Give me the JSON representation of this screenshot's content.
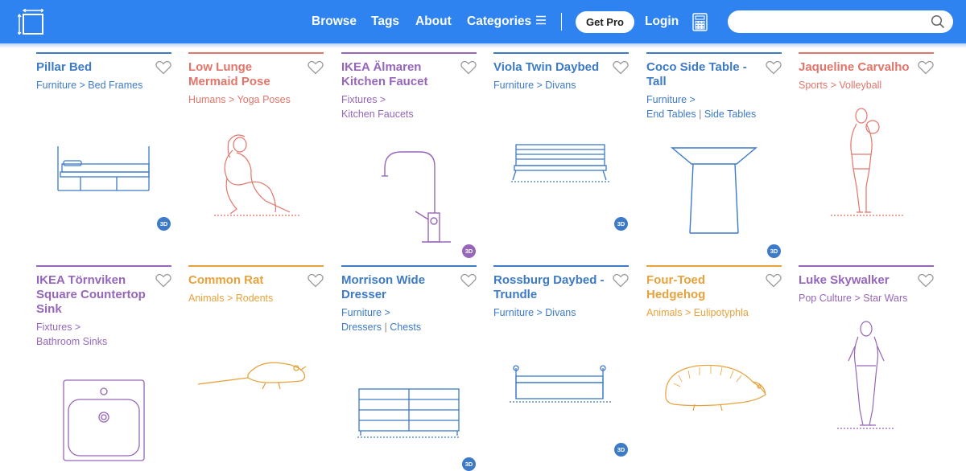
{
  "nav": {
    "logo_icon": "dimensions-logo-icon",
    "links": {
      "browse": "Browse",
      "tags": "Tags",
      "about": "About",
      "categories": "Categories"
    },
    "get_pro": "Get Pro",
    "login": "Login",
    "search_placeholder": "",
    "colors": {
      "bar": "#2e83f0",
      "text": "#ffffff"
    }
  },
  "cards": [
    {
      "title": "Pillar Bed",
      "cat1": "Furniture",
      "cat2": "Bed Frames",
      "color": "#3d7ac7",
      "badge": "3D",
      "illustration": "bed-illustration"
    },
    {
      "title": "Low Lunge Mermaid Pose",
      "cat1": "Humans",
      "cat2": "Yoga Poses",
      "color": "#e2756a",
      "illustration": "yoga-pose-illustration"
    },
    {
      "title": "IKEA Älmaren Kitchen Faucet",
      "cat1": "Fixtures",
      "cat2": "Kitchen Faucets",
      "color": "#9666ba",
      "badge": "3D",
      "illustration": "faucet-illustration"
    },
    {
      "title": "Viola Twin Daybed",
      "cat1": "Furniture",
      "cat2": "Divans",
      "color": "#3d7ac7",
      "badge": "3D",
      "illustration": "daybed-illustration"
    },
    {
      "title": "Coco Side Table - Tall",
      "cat1": "Furniture",
      "cat2a": "End Tables",
      "cat2b": "Side Tables",
      "color": "#3d7ac7",
      "badge": "3D",
      "illustration": "side-table-illustration"
    },
    {
      "title": "Jaqueline Carvalho",
      "cat1": "Sports",
      "cat2": "Volleyball",
      "color": "#e2756a",
      "illustration": "volleyball-player-illustration"
    },
    {
      "title": "IKEA Törnviken Square Countertop Sink",
      "cat1": "Fixtures",
      "cat2": "Bathroom Sinks",
      "color": "#9666ba",
      "illustration": "sink-illustration"
    },
    {
      "title": "Common Rat",
      "cat1": "Animals",
      "cat2": "Rodents",
      "color": "#e8a23c",
      "illustration": "rat-illustration"
    },
    {
      "title": "Morrison Wide Dresser",
      "cat1": "Furniture",
      "cat2a": "Dressers",
      "cat2b": "Chests",
      "color": "#3d7ac7",
      "badge": "3D",
      "illustration": "dresser-illustration"
    },
    {
      "title": "Rossburg Daybed - Trundle",
      "cat1": "Furniture",
      "cat2": "Divans",
      "color": "#3d7ac7",
      "badge": "3D",
      "illustration": "trundle-daybed-illustration"
    },
    {
      "title": "Four-Toed Hedgehog",
      "cat1": "Animals",
      "cat2": "Eulipotyphla",
      "color": "#e8a23c",
      "illustration": "hedgehog-illustration"
    },
    {
      "title": "Luke Skywalker",
      "cat1": "Pop Culture",
      "cat2": "Star Wars",
      "color": "#9666ba",
      "illustration": "luke-skywalker-illustration"
    }
  ]
}
